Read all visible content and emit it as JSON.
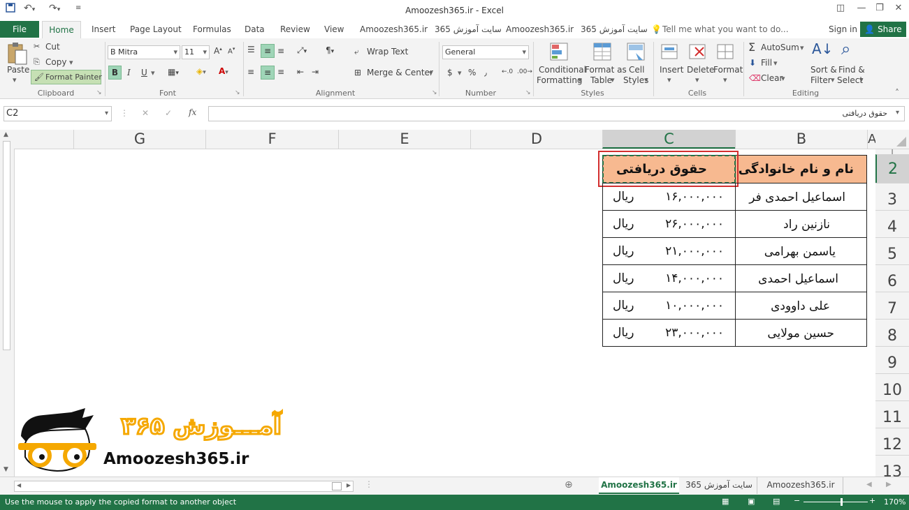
{
  "window": {
    "title": "Amoozesh365.ir - Excel",
    "controls": [
      "◫",
      "—",
      "❐",
      "✕"
    ]
  },
  "quick_access": {
    "save_icon": "save-icon",
    "undo_icon": "undo-icon",
    "redo_icon": "redo-icon"
  },
  "tabs": {
    "file": "File",
    "home": "Home",
    "items": [
      "Insert",
      "Page Layout",
      "Formulas",
      "Data",
      "Review",
      "View",
      "Amoozesh365.ir",
      "سایت آموزش 365",
      "Amoozesh365.ir",
      "سایت آموزش 365"
    ],
    "tell_me": "Tell me what you want to do...",
    "sign_in": "Sign in",
    "share": "Share"
  },
  "ribbon": {
    "clipboard": {
      "paste": "Paste",
      "cut": "Cut",
      "copy": "Copy",
      "format_painter": "Format Painter",
      "label": "Clipboard"
    },
    "font": {
      "name": "B Mitra",
      "size": "11",
      "label": "Font",
      "bold": "B",
      "italic": "I",
      "underline": "U"
    },
    "alignment": {
      "wrap_text": "Wrap Text",
      "merge_center": "Merge & Center",
      "label": "Alignment"
    },
    "number": {
      "format": "General",
      "currency": "$",
      "percent": "%",
      "comma": "٫",
      "label": "Number"
    },
    "styles": {
      "conditional": [
        "Conditional",
        "Formatting"
      ],
      "format_as": [
        "Format as",
        "Table"
      ],
      "cell_styles": [
        "Cell",
        "Styles"
      ],
      "label": "Styles"
    },
    "cells": {
      "insert": "Insert",
      "delete": "Delete",
      "format": "Format",
      "label": "Cells"
    },
    "editing": {
      "autosum": "AutoSum",
      "fill": "Fill",
      "clear": "Clear",
      "sort": [
        "Sort &",
        "Filter"
      ],
      "find": [
        "Find &",
        "Select"
      ],
      "label": "Editing"
    }
  },
  "formula_bar": {
    "name_box": "C2",
    "fx": "fx",
    "content": "حقوق دریافتی"
  },
  "columns": [
    "G",
    "F",
    "E",
    "D",
    "C",
    "B",
    "A"
  ],
  "rows": [
    "2",
    "3",
    "4",
    "5",
    "6",
    "7",
    "8",
    "9",
    "10",
    "11",
    "12",
    "13"
  ],
  "table": {
    "header_name": "نام و نام خانوادگی",
    "header_salary": "حقوق دریافتی",
    "currency": "ریال",
    "rows": [
      {
        "name": "اسماعیل احمدی فر",
        "salary": "۱۶,۰۰۰,۰۰۰"
      },
      {
        "name": "نازنین راد",
        "salary": "۲۶,۰۰۰,۰۰۰"
      },
      {
        "name": "یاسمن بهرامی",
        "salary": "۲۱,۰۰۰,۰۰۰"
      },
      {
        "name": "اسماعیل احمدی",
        "salary": "۱۴,۰۰۰,۰۰۰"
      },
      {
        "name": "علی داوودی",
        "salary": "۱۰,۰۰۰,۰۰۰"
      },
      {
        "name": "حسین مولایی",
        "salary": "۲۳,۰۰۰,۰۰۰"
      }
    ]
  },
  "logo": {
    "persian": "آمـــوزش ۳۶۵",
    "latin": "Amoozesh365.ir"
  },
  "sheets": [
    "Amoozesh365.ir",
    "سایت آموزش 365",
    "Amoozesh365.ir"
  ],
  "status": {
    "message": "Use the mouse to apply the copied format to another object",
    "zoom": "170%"
  },
  "colors": {
    "excel_green": "#217346",
    "header_fill": "#f7b990",
    "selection_red": "#d32f2f"
  }
}
